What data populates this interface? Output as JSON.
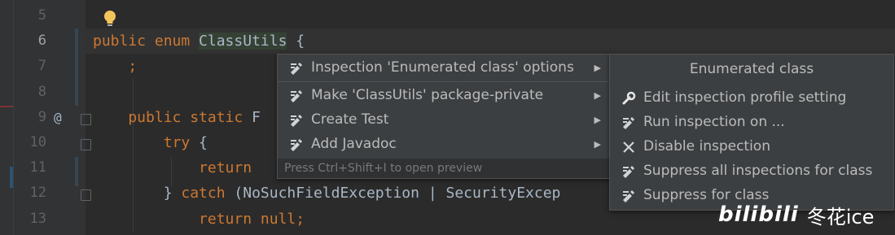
{
  "editor": {
    "line_numbers": [
      "5",
      "6",
      "7",
      "8",
      "9",
      "10",
      "11",
      "12",
      "13"
    ],
    "lines": [
      [],
      [
        {
          "t": "public enum ",
          "k": "kw"
        },
        {
          "t": "ClassUtils",
          "k": "cls"
        },
        {
          "t": " {",
          "k": ""
        }
      ],
      [
        {
          "t": "    ;",
          "k": "kw"
        }
      ],
      [],
      [
        {
          "t": "    public static ",
          "k": "kw"
        },
        {
          "t": "F",
          "k": ""
        }
      ],
      [
        {
          "t": "        try ",
          "k": "kw"
        },
        {
          "t": "{",
          "k": ""
        }
      ],
      [
        {
          "t": "            return ",
          "k": "kw"
        }
      ],
      [
        {
          "t": "        } ",
          "k": ""
        },
        {
          "t": "catch ",
          "k": "kw"
        },
        {
          "t": "(NoSuchFieldException | SecurityExcep",
          "k": ""
        }
      ],
      [
        {
          "t": "            return null",
          "k": "kw"
        },
        {
          "t": ";",
          "k": "kw"
        }
      ]
    ],
    "gutter_annotation": "@"
  },
  "context_menu": {
    "items": [
      {
        "label": "Inspection 'Enumerated class' options",
        "icon": "quickfix-icon",
        "selected": true
      },
      {
        "label": "Make 'ClassUtils' package-private",
        "icon": "quickfix-icon",
        "selected": false
      },
      {
        "label": "Create Test",
        "icon": "quickfix-icon",
        "selected": false
      },
      {
        "label": "Add Javadoc",
        "icon": "quickfix-icon",
        "selected": false
      }
    ],
    "hint": "Press Ctrl+Shift+I to open preview"
  },
  "submenu": {
    "title": "Enumerated class",
    "items": [
      {
        "label": "Edit inspection profile setting",
        "icon": "wrench-icon",
        "selected": true
      },
      {
        "label": "Run inspection on ...",
        "icon": "quickfix-icon",
        "selected": false
      },
      {
        "label": "Disable inspection",
        "icon": "close-icon",
        "selected": false
      },
      {
        "label": "Suppress all inspections for class",
        "icon": "quickfix-icon",
        "selected": false
      },
      {
        "label": "Suppress for class",
        "icon": "quickfix-icon",
        "selected": false
      }
    ]
  },
  "watermark": {
    "brand": "bilibili",
    "user": "冬花ice"
  },
  "colors": {
    "keyword": "#cc7832",
    "text": "#a9b7c6",
    "selection": "#4b6eaf",
    "background": "#2b2b2b"
  }
}
